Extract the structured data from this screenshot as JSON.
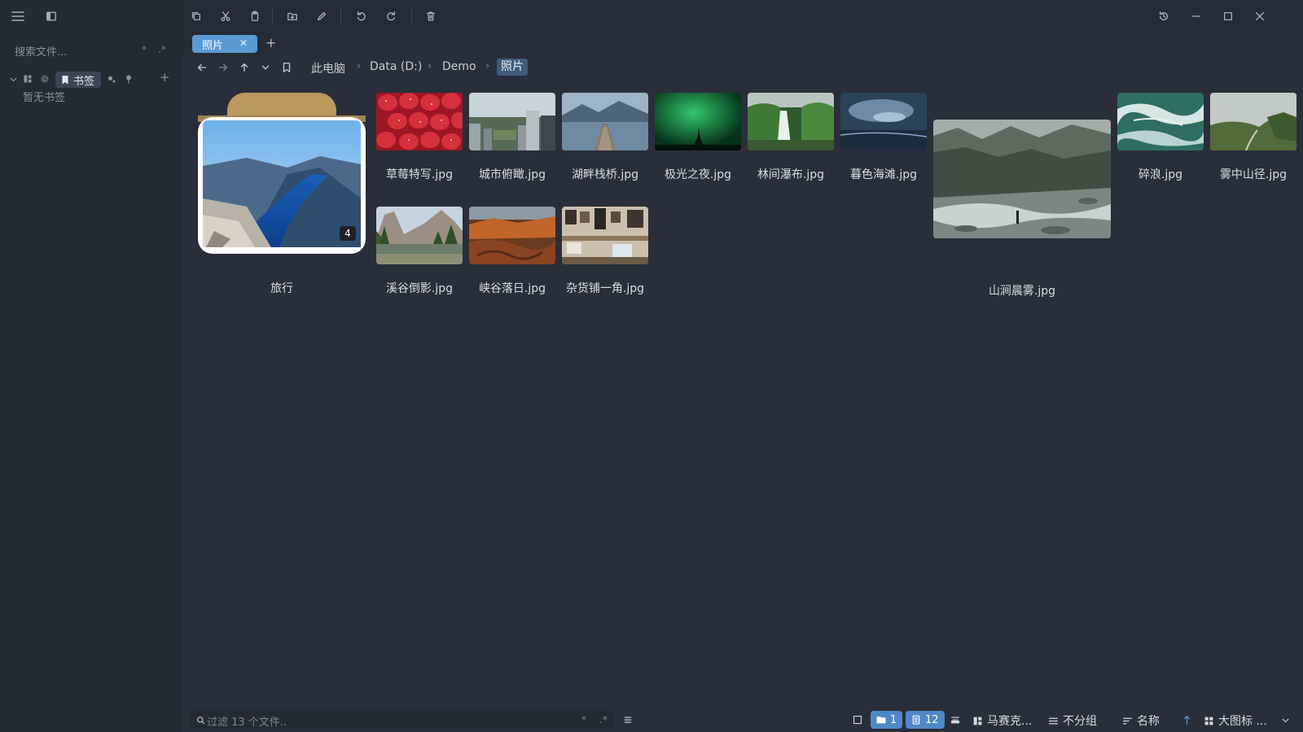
{
  "sidebar": {
    "search_placeholder": "搜索文件...",
    "search_opt_glob": "*",
    "search_opt_regex": ".*",
    "bookmarks_label": "书签",
    "empty_bookmarks": "暂无书签",
    "add_symbol": "+"
  },
  "tabs": [
    {
      "label": "照片",
      "close": "✕",
      "active": true
    }
  ],
  "tab_add": "+",
  "breadcrumb": {
    "items": [
      "此电脑",
      "Data (D:)",
      "Demo",
      "照片"
    ],
    "separator": "›"
  },
  "grid": {
    "folder": {
      "name": "旅行",
      "count": "4"
    },
    "files": [
      {
        "name": "草莓特写.jpg"
      },
      {
        "name": "城市俯瞰.jpg"
      },
      {
        "name": "湖畔栈桥.jpg"
      },
      {
        "name": "极光之夜.jpg"
      },
      {
        "name": "林间瀑布.jpg"
      },
      {
        "name": "暮色海滩.jpg"
      },
      {
        "name": "山涧晨雾.jpg"
      },
      {
        "name": "碎浪.jpg"
      },
      {
        "name": "雾中山径.jpg"
      },
      {
        "name": "溪谷倒影.jpg"
      },
      {
        "name": "峡谷落日.jpg"
      },
      {
        "name": "杂货铺一角.jpg"
      }
    ]
  },
  "status_bar": {
    "filter_placeholder": "过滤 13 个文件..",
    "filter_opt_glob": "*",
    "filter_opt_regex": ".*",
    "folder_count": "1",
    "file_count": "12",
    "layout": "马赛克...",
    "grouping": "不分组",
    "sort": "名称",
    "view": "大图标 ..."
  },
  "colors": {
    "accent": "#5b9bd5",
    "background": "#2a2e3a",
    "sidebar": "#252934"
  }
}
